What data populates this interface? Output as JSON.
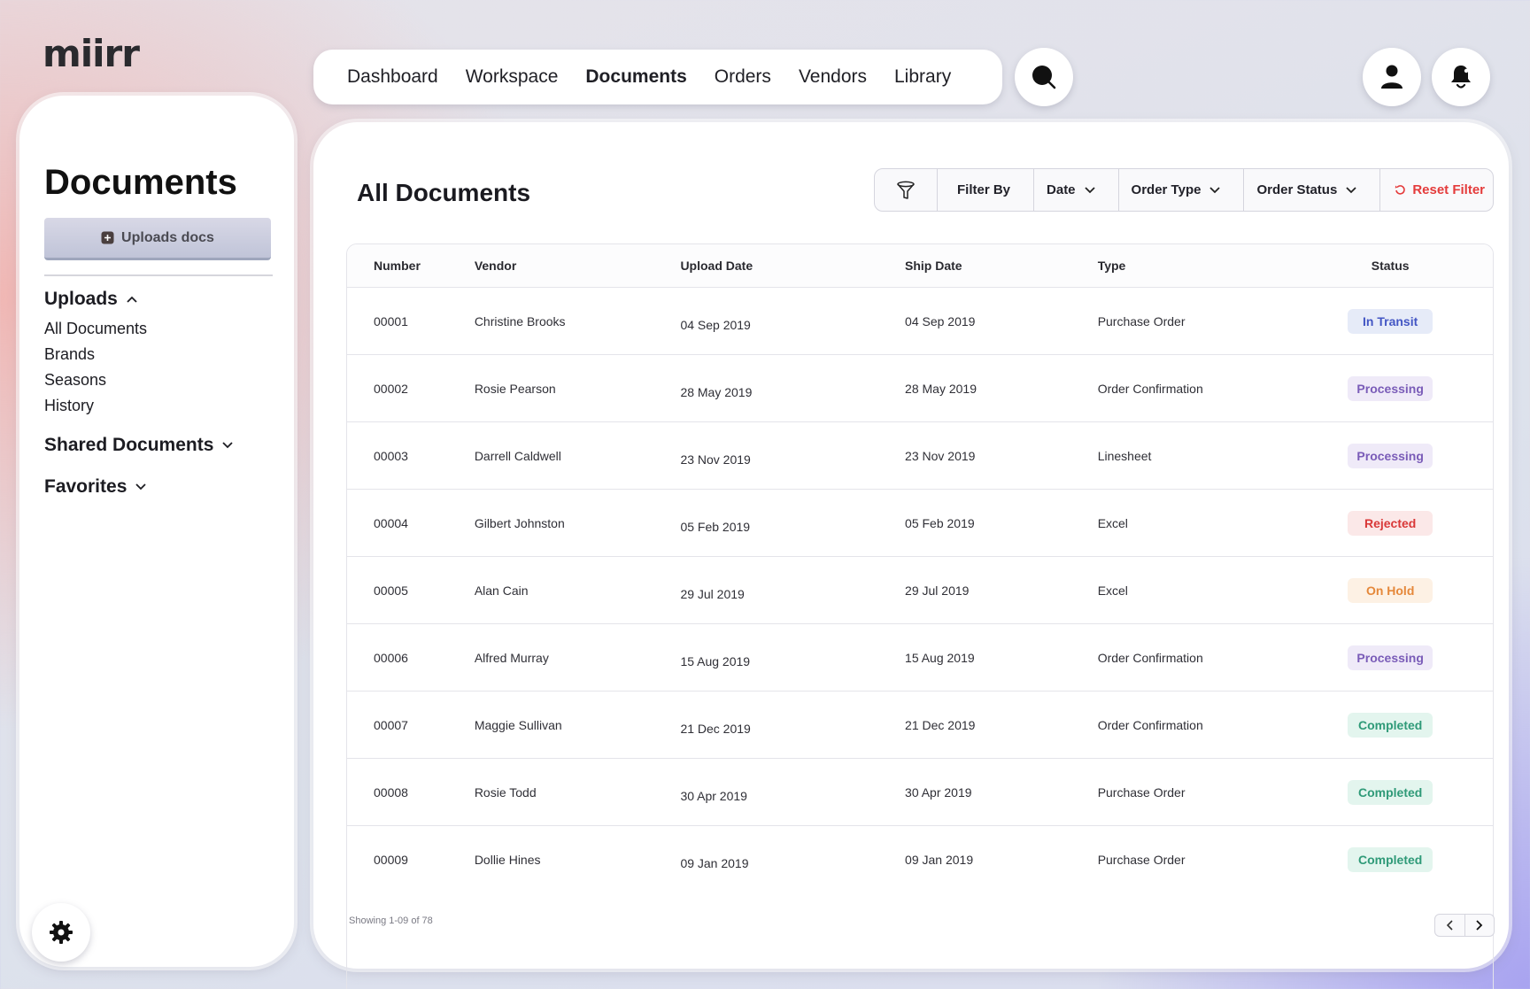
{
  "app": {
    "logo": "miirr"
  },
  "nav": {
    "items": [
      {
        "label": "Dashboard",
        "active": false
      },
      {
        "label": "Workspace",
        "active": false
      },
      {
        "label": "Documents",
        "active": true
      },
      {
        "label": "Orders",
        "active": false
      },
      {
        "label": "Vendors",
        "active": false
      },
      {
        "label": "Library",
        "active": false
      }
    ]
  },
  "icons": {
    "search": "search-icon",
    "user": "user-icon",
    "notifications": "bell-icon",
    "settings": "gear-icon",
    "filter": "filter-funnel-icon",
    "upload": "upload-icon"
  },
  "sidebar": {
    "title": "Documents",
    "upload_label": "Uploads docs",
    "uploads_label": "Uploads",
    "uploads_items": [
      "All Documents",
      "Brands",
      "Seasons",
      "History"
    ],
    "shared_label": "Shared Documents",
    "favorites_label": "Favorites"
  },
  "main": {
    "title": "All Documents",
    "filter": {
      "filter_by": "Filter By",
      "date": "Date",
      "order_type": "Order Type",
      "order_status": "Order Status",
      "reset": "Reset Filter"
    },
    "columns": [
      "Number",
      "Vendor",
      "Upload Date",
      "Ship Date",
      "Type",
      "Status"
    ],
    "rows": [
      {
        "number": "00001",
        "vendor": "Christine Brooks",
        "upload_date": "04 Sep 2019",
        "ship_date": "04 Sep 2019",
        "type": "Purchase Order",
        "status": "In Transit"
      },
      {
        "number": "00002",
        "vendor": "Rosie Pearson",
        "upload_date": "28 May 2019",
        "ship_date": "28 May 2019",
        "type": "Order Confirmation",
        "status": "Processing"
      },
      {
        "number": "00003",
        "vendor": "Darrell Caldwell",
        "upload_date": "23 Nov 2019",
        "ship_date": "23 Nov 2019",
        "type": "Linesheet",
        "status": "Processing"
      },
      {
        "number": "00004",
        "vendor": "Gilbert Johnston",
        "upload_date": "05 Feb 2019",
        "ship_date": "05 Feb 2019",
        "type": "Excel",
        "status": "Rejected"
      },
      {
        "number": "00005",
        "vendor": "Alan Cain",
        "upload_date": "29 Jul 2019",
        "ship_date": "29 Jul 2019",
        "type": "Excel",
        "status": "On Hold"
      },
      {
        "number": "00006",
        "vendor": "Alfred Murray",
        "upload_date": "15 Aug 2019",
        "ship_date": "15 Aug 2019",
        "type": "Order Confirmation",
        "status": "Processing"
      },
      {
        "number": "00007",
        "vendor": "Maggie Sullivan",
        "upload_date": "21 Dec 2019",
        "ship_date": "21 Dec 2019",
        "type": "Order Confirmation",
        "status": "Completed"
      },
      {
        "number": "00008",
        "vendor": "Rosie Todd",
        "upload_date": "30 Apr 2019",
        "ship_date": "30 Apr 2019",
        "type": "Purchase Order",
        "status": "Completed"
      },
      {
        "number": "00009",
        "vendor": "Dollie Hines",
        "upload_date": "09 Jan 2019",
        "ship_date": "09 Jan 2019",
        "type": "Purchase Order",
        "status": "Completed"
      }
    ],
    "status_colors": {
      "In Transit": {
        "fg": "#4356c4",
        "bg": "#e6ebf8"
      },
      "Processing": {
        "fg": "#7a5cb8",
        "bg": "#efeaf8"
      },
      "Rejected": {
        "fg": "#d93838",
        "bg": "#fbe8e8"
      },
      "On Hold": {
        "fg": "#e5883a",
        "bg": "#fdf1e4"
      },
      "Completed": {
        "fg": "#2f9a78",
        "bg": "#e3f5ee"
      }
    },
    "footer": "Showing 1-09 of 78"
  },
  "colors": {
    "reset_filter": "#e43b3b"
  }
}
